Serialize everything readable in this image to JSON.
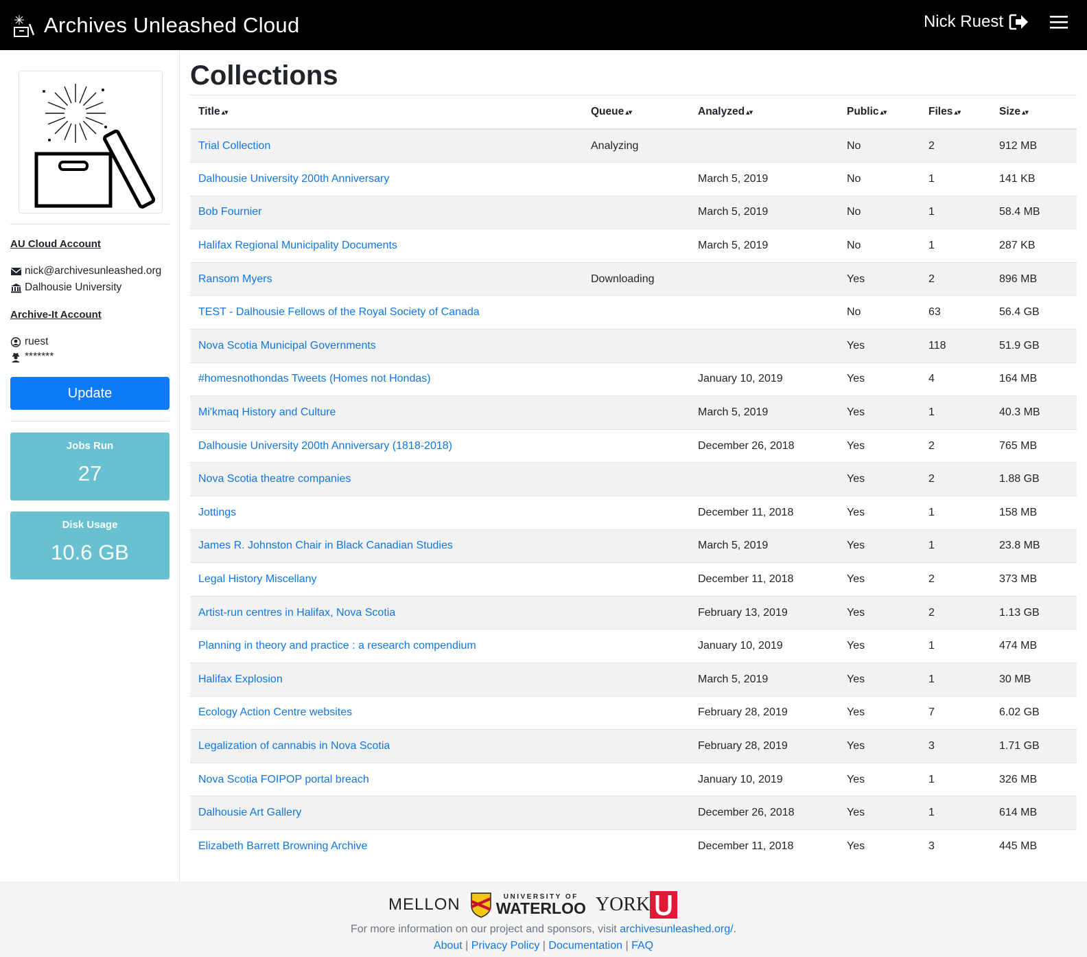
{
  "navbar": {
    "title": "Archives Unleashed Cloud",
    "user_name": "Nick Ruest"
  },
  "sidebar": {
    "au_account_heading": "AU Cloud Account",
    "email": "nick@archivesunleashed.org",
    "institution": "Dalhousie University",
    "ai_account_heading": "Archive-It Account",
    "ai_username": "ruest",
    "ai_password": "*******",
    "update_label": "Update",
    "jobs_label": "Jobs Run",
    "jobs_value": "27",
    "disk_label": "Disk Usage",
    "disk_value": "10.6 GB"
  },
  "main": {
    "title": "Collections",
    "columns": [
      "Title",
      "Queue",
      "Analyzed",
      "Public",
      "Files",
      "Size"
    ],
    "sort_glyph": "▴▾",
    "rows": [
      {
        "title": "Trial Collection",
        "queue": "Analyzing",
        "analyzed": "",
        "public": "No",
        "files": "2",
        "size": "912 MB"
      },
      {
        "title": "Dalhousie University 200th Anniversary",
        "queue": "",
        "analyzed": "March 5, 2019",
        "public": "No",
        "files": "1",
        "size": "141 KB"
      },
      {
        "title": "Bob Fournier",
        "queue": "",
        "analyzed": "March 5, 2019",
        "public": "No",
        "files": "1",
        "size": "58.4 MB"
      },
      {
        "title": "Halifax Regional Municipality Documents",
        "queue": "",
        "analyzed": "March 5, 2019",
        "public": "No",
        "files": "1",
        "size": "287 KB"
      },
      {
        "title": "Ransom Myers",
        "queue": "Downloading",
        "analyzed": "",
        "public": "Yes",
        "files": "2",
        "size": "896 MB"
      },
      {
        "title": "TEST - Dalhousie Fellows of the Royal Society of Canada",
        "queue": "",
        "analyzed": "",
        "public": "No",
        "files": "63",
        "size": "56.4 GB"
      },
      {
        "title": "Nova Scotia Municipal Governments",
        "queue": "",
        "analyzed": "",
        "public": "Yes",
        "files": "118",
        "size": "51.9 GB"
      },
      {
        "title": "#homesnothondas Tweets (Homes not Hondas)",
        "queue": "",
        "analyzed": "January 10, 2019",
        "public": "Yes",
        "files": "4",
        "size": "164 MB"
      },
      {
        "title": "Mi'kmaq History and Culture",
        "queue": "",
        "analyzed": "March 5, 2019",
        "public": "Yes",
        "files": "1",
        "size": "40.3 MB"
      },
      {
        "title": "Dalhousie University 200th Anniversary (1818-2018)",
        "queue": "",
        "analyzed": "December 26, 2018",
        "public": "Yes",
        "files": "2",
        "size": "765 MB"
      },
      {
        "title": "Nova Scotia theatre companies",
        "queue": "",
        "analyzed": "",
        "public": "Yes",
        "files": "2",
        "size": "1.88 GB"
      },
      {
        "title": "Jottings",
        "queue": "",
        "analyzed": "December 11, 2018",
        "public": "Yes",
        "files": "1",
        "size": "158 MB"
      },
      {
        "title": "James R. Johnston Chair in Black Canadian Studies",
        "queue": "",
        "analyzed": "March 5, 2019",
        "public": "Yes",
        "files": "1",
        "size": "23.8 MB"
      },
      {
        "title": "Legal History Miscellany",
        "queue": "",
        "analyzed": "December 11, 2018",
        "public": "Yes",
        "files": "2",
        "size": "373 MB"
      },
      {
        "title": "Artist-run centres in Halifax, Nova Scotia",
        "queue": "",
        "analyzed": "February 13, 2019",
        "public": "Yes",
        "files": "2",
        "size": "1.13 GB"
      },
      {
        "title": "Planning in theory and practice : a research compendium",
        "queue": "",
        "analyzed": "January 10, 2019",
        "public": "Yes",
        "files": "1",
        "size": "474 MB"
      },
      {
        "title": "Halifax Explosion",
        "queue": "",
        "analyzed": "March 5, 2019",
        "public": "Yes",
        "files": "1",
        "size": "30 MB"
      },
      {
        "title": "Ecology Action Centre websites",
        "queue": "",
        "analyzed": "February 28, 2019",
        "public": "Yes",
        "files": "7",
        "size": "6.02 GB"
      },
      {
        "title": "Legalization of cannabis in Nova Scotia",
        "queue": "",
        "analyzed": "February 28, 2019",
        "public": "Yes",
        "files": "3",
        "size": "1.71 GB"
      },
      {
        "title": "Nova Scotia FOIPOP portal breach",
        "queue": "",
        "analyzed": "January 10, 2019",
        "public": "Yes",
        "files": "1",
        "size": "326 MB"
      },
      {
        "title": "Dalhousie Art Gallery",
        "queue": "",
        "analyzed": "December 26, 2018",
        "public": "Yes",
        "files": "1",
        "size": "614 MB"
      },
      {
        "title": "Elizabeth Barrett Browning Archive",
        "queue": "",
        "analyzed": "December 11, 2018",
        "public": "Yes",
        "files": "3",
        "size": "445 MB"
      }
    ]
  },
  "footer": {
    "sponsor_mellon": "MELLON",
    "sponsor_waterloo_top": "UNIVERSITY OF",
    "sponsor_waterloo": "WATERLOO",
    "sponsor_york": "YORK",
    "info_text": "For more information on our project and sponsors, visit ",
    "info_link": "archivesunleashed.org/",
    "info_end": ".",
    "links": [
      "About",
      "Privacy Policy",
      "Documentation",
      "FAQ"
    ],
    "separator": " | "
  },
  "colors": {
    "navbar_bg": "#000000",
    "link": "#1177e0",
    "primary_button": "#0d7af7",
    "stat_card": "#67c1d1",
    "stripe": "#f2f2f2"
  }
}
